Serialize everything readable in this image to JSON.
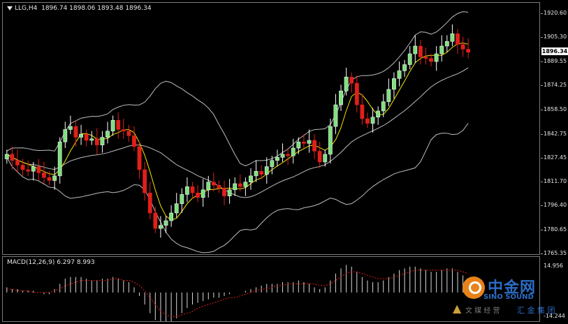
{
  "chart_header": {
    "symbol": "LLG,H4",
    "ohlc": "1896.74 1898.06 1893.48 1896.34"
  },
  "indicator_header": {
    "label": "MACD(12,26,9) 6.297 8.993"
  },
  "price_axis": {
    "ticks": [
      "1920.60",
      "1905.30",
      "1889.55",
      "1874.25",
      "1858.50",
      "1842.75",
      "1827.45",
      "1811.70",
      "1796.40",
      "1780.65",
      "1765.35"
    ],
    "current_price": "1896.34"
  },
  "macd_axis": {
    "ticks": [
      "14.956",
      "-14.244"
    ]
  },
  "watermark": {
    "main": "中金网",
    "sub": "SINO SOUND",
    "tag": "汇 金 集 团",
    "side": "文 媒 经 营"
  },
  "colors": {
    "background": "#000000",
    "bull": "#ffffff",
    "bull_body": "#7fe07f",
    "bear": "#e0201a",
    "ma": "#f2e600",
    "bands": "#bdbdbd",
    "macd_hist": "#d9d9d9",
    "macd_signal": "#e0201a"
  },
  "chart_data": {
    "type": "candlestick",
    "symbol": "LLG",
    "timeframe": "H4",
    "ylim": [
      1765.35,
      1928
    ],
    "close_path": [
      1830,
      1826,
      1823,
      1820,
      1819,
      1822,
      1818,
      1815,
      1813,
      1816,
      1838,
      1846,
      1848,
      1841,
      1843,
      1839,
      1840,
      1836,
      1841,
      1845,
      1852,
      1846,
      1845,
      1842,
      1835,
      1820,
      1805,
      1792,
      1782,
      1784,
      1787,
      1792,
      1798,
      1804,
      1809,
      1805,
      1802,
      1807,
      1812,
      1810,
      1808,
      1803,
      1807,
      1811,
      1809,
      1812,
      1816,
      1819,
      1817,
      1822,
      1826,
      1828,
      1830,
      1829,
      1834,
      1838,
      1837,
      1839,
      1832,
      1825,
      1830,
      1848,
      1862,
      1871,
      1880,
      1876,
      1862,
      1853,
      1850,
      1854,
      1858,
      1864,
      1872,
      1879,
      1884,
      1888,
      1895,
      1900,
      1893,
      1892,
      1890,
      1895,
      1900,
      1903,
      1908,
      1901,
      1898,
      1896
    ],
    "macd_hist": [
      3,
      2,
      2,
      1,
      1,
      1,
      0,
      -1,
      -1,
      2,
      5,
      8,
      9,
      9,
      9,
      8,
      7,
      7,
      8,
      8,
      9,
      8,
      7,
      6,
      3,
      -2,
      -7,
      -12,
      -16,
      -18,
      -18,
      -17,
      -15,
      -12,
      -9,
      -7,
      -6,
      -5,
      -4,
      -3,
      -3,
      -2,
      -1,
      0,
      0,
      1,
      2,
      3,
      4,
      5,
      5,
      5,
      6,
      6,
      6,
      7,
      6,
      5,
      3,
      2,
      3,
      7,
      11,
      14,
      16,
      15,
      12,
      9,
      7,
      6,
      6,
      7,
      9,
      11,
      13,
      14,
      15,
      15,
      14,
      13,
      12,
      12,
      13,
      14,
      14,
      12,
      10,
      8
    ],
    "macd_signal": [
      2,
      2,
      1,
      1,
      1,
      0,
      0,
      0,
      0,
      1,
      2,
      4,
      5,
      6,
      7,
      7,
      7,
      7,
      7,
      7,
      8,
      8,
      7,
      7,
      6,
      4,
      1,
      -3,
      -7,
      -11,
      -13,
      -14,
      -14,
      -13,
      -12,
      -11,
      -9,
      -8,
      -7,
      -6,
      -5,
      -4,
      -3,
      -3,
      -2,
      -1,
      0,
      1,
      2,
      2,
      3,
      4,
      4,
      5,
      5,
      5,
      5,
      5,
      5,
      4,
      4,
      5,
      7,
      9,
      11,
      12,
      12,
      11,
      10,
      9,
      8,
      8,
      8,
      9,
      10,
      11,
      12,
      13,
      13,
      13,
      13,
      13,
      13,
      13,
      13,
      13,
      12,
      11
    ],
    "macd_range": [
      -14.244,
      14.956
    ]
  }
}
